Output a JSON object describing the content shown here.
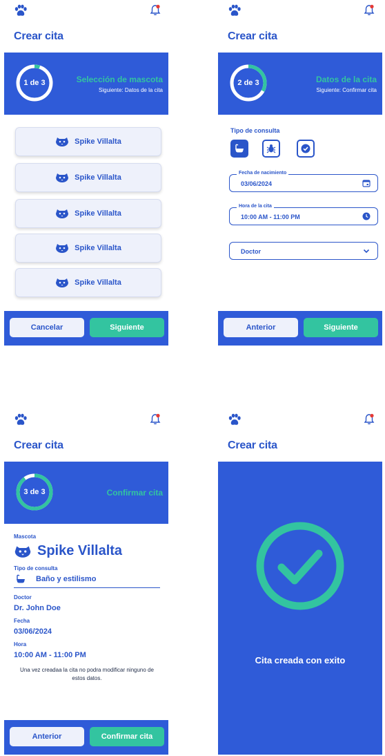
{
  "app": {
    "title": "Crear cita",
    "icons": {
      "logo": "paw-icon",
      "notifications": "bell-icon"
    },
    "colors": {
      "primary": "#2f5bd8",
      "accent": "#33c4a0",
      "light": "#eef1fb",
      "notification_dot": "#e53935"
    }
  },
  "step1": {
    "progress_text": "1 de 3",
    "progress_fraction": 0.05,
    "step_title": "Selección de mascota",
    "next_text": "Siguiente: Datos de la cita",
    "pets": [
      {
        "name": "Spike Villalta",
        "icon": "pet-face-icon"
      },
      {
        "name": "Spike Villalta",
        "icon": "pet-face-icon"
      },
      {
        "name": "Spike Villalta",
        "icon": "pet-face-icon"
      },
      {
        "name": "Spike Villalta",
        "icon": "pet-face-icon"
      },
      {
        "name": "Spike Villalta",
        "icon": "pet-face-icon"
      }
    ],
    "cancel_label": "Cancelar",
    "next_label": "Siguiente"
  },
  "step2": {
    "progress_text": "2 de 3",
    "progress_fraction": 0.33,
    "step_title": "Datos de la cita",
    "next_text": "Siguiente: Confirmar cita",
    "type_label": "Tipo de consulta",
    "types": [
      {
        "icon": "bathtub-icon",
        "selected": true
      },
      {
        "icon": "bug-icon",
        "selected": false
      },
      {
        "icon": "check-circle-icon",
        "selected": false
      }
    ],
    "date_field": {
      "label": "Fecha de nacimiento",
      "value": "03/06/2024",
      "icon": "calendar-icon"
    },
    "time_field": {
      "label": "Hora de la cita",
      "value": "10:00 AM - 11:00 PM",
      "icon": "clock-icon"
    },
    "doctor_select": {
      "value": "Doctor",
      "icon": "chevron-down-icon"
    },
    "back_label": "Anterior",
    "next_label": "Siguiente"
  },
  "step3": {
    "progress_text": "3 de 3",
    "progress_fraction": 0.9,
    "step_title": "Confirmar cita",
    "pet_label": "Mascota",
    "pet_name": "Spike Villalta",
    "type_label": "Tipo de consulta",
    "type_value": "Baño y estilismo",
    "doctor_label": "Doctor",
    "doctor_value": "Dr. John Doe",
    "date_label": "Fecha",
    "date_value": "03/06/2024",
    "time_label": "Hora",
    "time_value": "10:00 AM - 11:00 PM",
    "note": "Una vez creadaa la cita no podra modificar ninguno de estos datos.",
    "back_label": "Anterior",
    "confirm_label": "Confirmar cita"
  },
  "step4": {
    "success_text": "Cita creada con exito",
    "icon": "check-circle-icon"
  }
}
